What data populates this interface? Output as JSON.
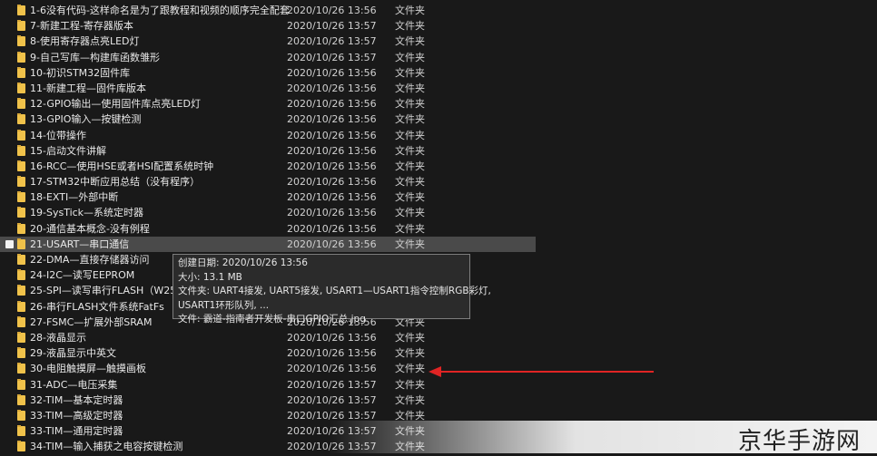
{
  "files": [
    {
      "name": "1-6没有代码-这样命名是为了跟教程和视频的顺序完全配套",
      "date": "2020/10/26 13:56",
      "type": "文件夹"
    },
    {
      "name": "7-新建工程-寄存器版本",
      "date": "2020/10/26 13:57",
      "type": "文件夹"
    },
    {
      "name": "8-使用寄存器点亮LED灯",
      "date": "2020/10/26 13:57",
      "type": "文件夹"
    },
    {
      "name": "9-自己写库—构建库函数雏形",
      "date": "2020/10/26 13:57",
      "type": "文件夹"
    },
    {
      "name": "10-初识STM32固件库",
      "date": "2020/10/26 13:56",
      "type": "文件夹"
    },
    {
      "name": "11-新建工程—固件库版本",
      "date": "2020/10/26 13:56",
      "type": "文件夹"
    },
    {
      "name": "12-GPIO输出—使用固件库点亮LED灯",
      "date": "2020/10/26 13:56",
      "type": "文件夹"
    },
    {
      "name": "13-GPIO输入—按键检测",
      "date": "2020/10/26 13:56",
      "type": "文件夹"
    },
    {
      "name": "14-位带操作",
      "date": "2020/10/26 13:56",
      "type": "文件夹"
    },
    {
      "name": "15-启动文件讲解",
      "date": "2020/10/26 13:56",
      "type": "文件夹"
    },
    {
      "name": "16-RCC—使用HSE或者HSI配置系统时钟",
      "date": "2020/10/26 13:56",
      "type": "文件夹"
    },
    {
      "name": "17-STM32中断应用总结（没有程序）",
      "date": "2020/10/26 13:56",
      "type": "文件夹"
    },
    {
      "name": "18-EXTI—外部中断",
      "date": "2020/10/26 13:56",
      "type": "文件夹"
    },
    {
      "name": "19-SysTick—系统定时器",
      "date": "2020/10/26 13:56",
      "type": "文件夹"
    },
    {
      "name": "20-通信基本概念-没有例程",
      "date": "2020/10/26 13:56",
      "type": "文件夹"
    },
    {
      "name": "21-USART—串口通信",
      "date": "2020/10/26 13:56",
      "type": "文件夹",
      "selected": true
    },
    {
      "name": "22-DMA—直接存储器访问",
      "date": "",
      "type": ""
    },
    {
      "name": "24-I2C—读写EEPROM",
      "date": "",
      "type": ""
    },
    {
      "name": "25-SPI—读写串行FLASH（W25Q64",
      "date": "",
      "type": ""
    },
    {
      "name": "26-串行FLASH文件系统FatFs",
      "date": "",
      "type": ""
    },
    {
      "name": "27-FSMC—扩展外部SRAM",
      "date": "2020/10/26 13:56",
      "type": "文件夹"
    },
    {
      "name": "28-液晶显示",
      "date": "2020/10/26 13:56",
      "type": "文件夹"
    },
    {
      "name": "29-液晶显示中英文",
      "date": "2020/10/26 13:56",
      "type": "文件夹"
    },
    {
      "name": "30-电阻触摸屏—触摸画板",
      "date": "2020/10/26 13:56",
      "type": "文件夹"
    },
    {
      "name": "31-ADC—电压采集",
      "date": "2020/10/26 13:57",
      "type": "文件夹"
    },
    {
      "name": "32-TIM—基本定时器",
      "date": "2020/10/26 13:57",
      "type": "文件夹"
    },
    {
      "name": "33-TIM—高级定时器",
      "date": "2020/10/26 13:57",
      "type": "文件夹"
    },
    {
      "name": "33-TIM—通用定时器",
      "date": "2020/10/26 13:57",
      "type": "文件夹"
    },
    {
      "name": "34-TIM—输入捕获之电容按键检测",
      "date": "2020/10/26 13:57",
      "type": "文件夹"
    }
  ],
  "tooltip": {
    "line1": "创建日期: 2020/10/26 13:56",
    "line2": "大小: 13.1 MB",
    "line3": "文件夹: UART4接发, UART5接发, USART1—USART1指令控制RGB彩灯,",
    "line4": "USART1环形队列, ...",
    "line5": "文件: 霸道-指南者开发板-串口GPIO汇总.jpg"
  },
  "watermark": "京华手游网",
  "colors": {
    "folder": "#f0c24a",
    "arrow": "#e02424",
    "selected": "#4a4a4a"
  }
}
